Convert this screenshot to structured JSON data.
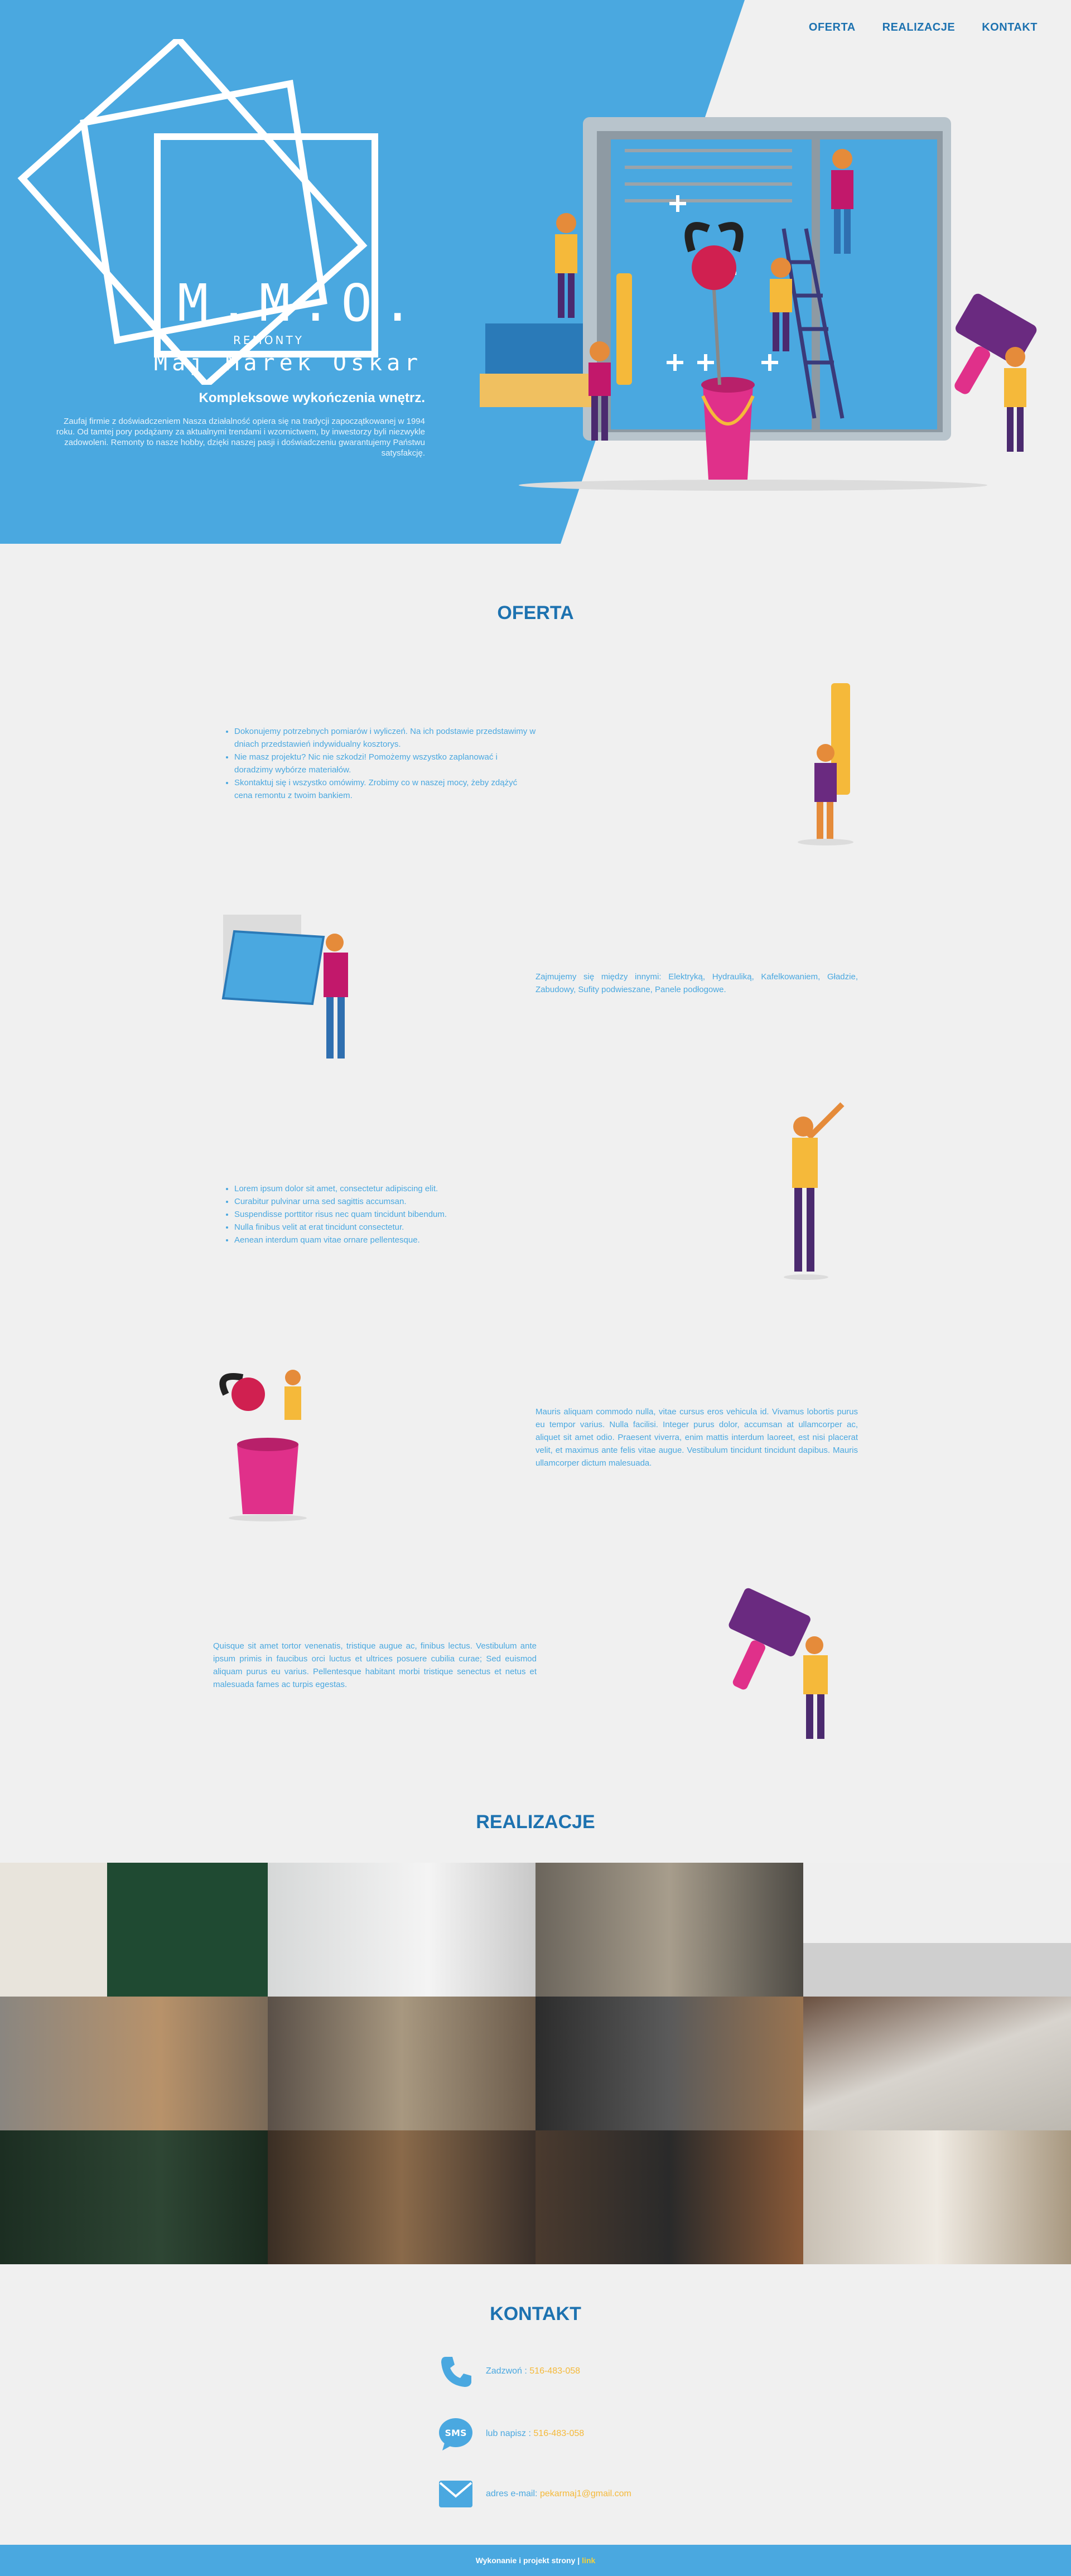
{
  "nav": {
    "items": [
      "OFERTA",
      "REALIZACJE",
      "KONTAKT"
    ]
  },
  "hero": {
    "logo_letters": "M.M.O.",
    "logo_sub": "REMONTY",
    "logo_name": "Maj Marek Oskar",
    "heading": "Kompleksowe wykończenia wnętrz.",
    "text": "Zaufaj firmie z doświadczeniem Nasza działalność opiera się na tradycji zapoczątkowanej w 1994 roku. Od tamtej pory podążamy za aktualnymi trendami i wzornictwem, by inwestorzy byli niezwykle zadowoleni. Remonty to nasze hobby, dzięki naszej pasji i doświadczeniu gwarantujemy Państwu satysfakcję."
  },
  "offer": {
    "title": "OFERTA",
    "block1": [
      "Dokonujemy potrzebnych pomiarów i wyliczeń. Na ich podstawie przedstawimy w dniach przedstawień indywidualny kosztorys.",
      "Nie masz projektu? Nic nie szkodzi! Pomożemy wszystko zaplanować i doradzimy wybórze materiałów.",
      "Skontaktuj się i wszystko omówimy. Zrobimy co w naszej mocy, żeby zdążyć cena remontu z twoim bankiem."
    ],
    "block2": "Zajmujemy się między innymi: Elektryką, Hydrauliką, Kafelkowaniem, Gładzie, Zabudowy, Sufity podwieszane, Panele podłogowe.",
    "block3": [
      "Lorem ipsum dolor sit amet, consectetur adipiscing elit.",
      "Curabitur pulvinar urna sed sagittis accumsan.",
      "Suspendisse porttitor risus nec quam tincidunt bibendum.",
      "Nulla finibus velit at erat tincidunt consectetur.",
      "Aenean interdum quam vitae ornare pellentesque."
    ],
    "block4": "Mauris aliquam commodo nulla, vitae cursus eros vehicula id. Vivamus lobortis purus eu tempor varius. Nulla facilisi. Integer purus dolor, accumsan at ullamcorper ac, aliquet sit amet odio. Praesent viverra, enim mattis interdum laoreet, est nisi placerat velit, et maximus ante felis vitae augue. Vestibulum tincidunt tincidunt dapibus. Mauris ullamcorper dictum malesuada.",
    "block5": "Quisque sit amet tortor venenatis, tristique augue ac, finibus lectus. Vestibulum ante ipsum primis in faucibus orci luctus et ultrices posuere cubilia curae; Sed euismod aliquam purus eu varius. Pellentesque habitant morbi tristique senectus et netus et malesuada fames ac turpis egestas."
  },
  "gallery": {
    "title": "REALIZACJE"
  },
  "contact": {
    "title": "KONTAKT",
    "phone_label": "Zadzwoń :",
    "phone_value": "516-483-058",
    "sms_label": "lub napisz :",
    "sms_value": "516-483-058",
    "sms_icon_text": "SMS",
    "email_label": "adres e-mail:",
    "email_value": "pekarmaj1@gmail.com"
  },
  "footer": {
    "text": "Wykonanie i projekt strony |",
    "link": "link"
  },
  "colors": {
    "accent": "#4aa8e0",
    "nav": "#1d72b0",
    "highlight": "#f5b93a",
    "background": "#f0f0f0"
  }
}
